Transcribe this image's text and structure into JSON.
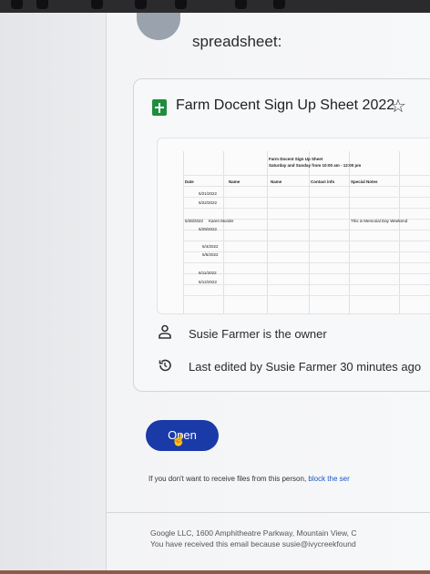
{
  "email": {
    "heading": "spreadsheet:",
    "file_name": "Farm Docent Sign Up Sheet 2022",
    "owner_text": "Susie Farmer is the owner",
    "edited_text": "Last edited by Susie Farmer 30 minutes ago",
    "open_label": "Open",
    "notice_text": "If you don't want to receive files from this person, ",
    "notice_link": "block the ser",
    "footer_line1": "Google LLC, 1600 Amphitheatre Parkway, Mountain View, C",
    "footer_line2": "You have received this email because susie@ivycreekfound"
  },
  "preview": {
    "title": "Farm Docent Sign Up Sheet",
    "subtitle": "Saturday and Sunday from 10:00 am - 12:00 pm",
    "headers": [
      "Date",
      "Name",
      "Name",
      "Contact info",
      "Special Notes"
    ],
    "rows": [
      {
        "date": "5/21/2022",
        "name": "",
        "note": ""
      },
      {
        "date": "5/22/2022",
        "name": "",
        "note": ""
      },
      {
        "date": "5/28/2022",
        "name": "Karen Murder",
        "note": "This is Memorial Day Weekend"
      },
      {
        "date": "5/29/2022",
        "name": "",
        "note": ""
      },
      {
        "date": "6/4/2022",
        "name": "",
        "note": ""
      },
      {
        "date": "6/5/2022",
        "name": "",
        "note": ""
      },
      {
        "date": "6/11/2022",
        "name": "",
        "note": ""
      },
      {
        "date": "6/12/2022",
        "name": "",
        "note": ""
      }
    ]
  },
  "icons": {
    "star": "star-outline-icon",
    "owner": "person-icon",
    "history": "history-icon",
    "file": "google-sheets-icon"
  },
  "colors": {
    "open_button": "#1a3aa8",
    "sheets_green": "#1e8e3e",
    "link": "#1a54c4"
  }
}
